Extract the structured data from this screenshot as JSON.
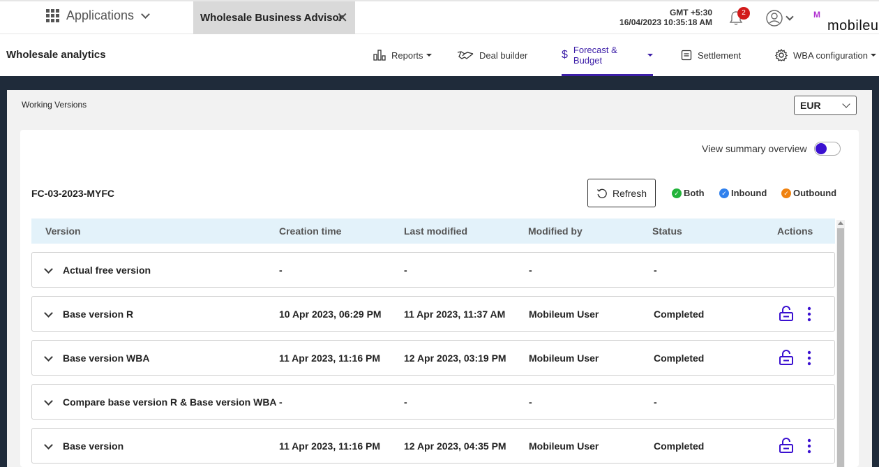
{
  "topbar": {
    "apps_label": "Applications",
    "app_tab": "Wholesale Business Advisor",
    "timezone": "GMT +5:30",
    "datetime": "16/04/2023 10:35:18 AM",
    "notifications": "2",
    "brand": "mobileu"
  },
  "nav": {
    "title": "Wholesale analytics",
    "items": [
      {
        "label": "Reports"
      },
      {
        "label": "Deal builder"
      },
      {
        "label": "Forecast & Budget"
      },
      {
        "label": "Settlement"
      },
      {
        "label": "WBA configuration"
      }
    ],
    "active": "Forecast & Budget",
    "accent": "#3d1fa8"
  },
  "page": {
    "section_title": "Working Versions",
    "currency": "EUR",
    "summary_toggle_label": "View summary overview",
    "forecast_name": "FC-03-2023-MYFC",
    "refresh_label": "Refresh",
    "legend": [
      {
        "label": "Both",
        "color": "#22b33a"
      },
      {
        "label": "Inbound",
        "color": "#2f80ed"
      },
      {
        "label": "Outbound",
        "color": "#f0820f"
      }
    ]
  },
  "table": {
    "columns": [
      "Version",
      "Creation time",
      "Last modified",
      "Modified by",
      "Status",
      "Actions"
    ],
    "rows": [
      {
        "version": "Actual free version",
        "created": "-",
        "modified": "-",
        "by": "-",
        "status": "-"
      },
      {
        "version": "Base version R",
        "created": "10 Apr 2023, 06:29 PM",
        "modified": "11 Apr 2023, 11:37 AM",
        "by": "Mobileum User",
        "status": "Completed"
      },
      {
        "version": "Base version WBA",
        "created": "11 Apr 2023, 11:16 PM",
        "modified": "12 Apr 2023, 03:19 PM",
        "by": "Mobileum User",
        "status": "Completed"
      },
      {
        "version": "Compare base version R & Base version WBA",
        "created": "-",
        "modified": "-",
        "by": "-",
        "status": "-"
      },
      {
        "version": "Base version",
        "created": "11 Apr 2023, 11:16 PM",
        "modified": "12 Apr 2023, 04:35 PM",
        "by": "Mobileum User",
        "status": "Completed"
      }
    ]
  }
}
